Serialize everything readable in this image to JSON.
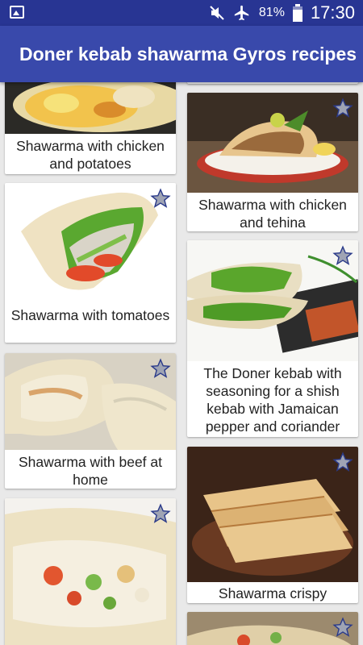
{
  "status_bar": {
    "battery_percent": "81%",
    "time": "17:30",
    "icons": [
      "image-icon",
      "mute-icon",
      "airplane-icon",
      "battery-icon"
    ]
  },
  "app": {
    "title": "Doner kebab shawarma Gyros recipes"
  },
  "colors": {
    "status_bar": "#283593",
    "app_bar": "#3949ab",
    "background": "#e9e9e9",
    "star_fill": "#9fa4b4",
    "star_stroke": "#2a3a8a"
  },
  "recipes": [
    {
      "title": "Shawarma with chicken and potatoes",
      "favorite": false
    },
    {
      "title": "Shawarma with chicken and tehina",
      "favorite": false
    },
    {
      "title": "Shawarma with tomatoes",
      "favorite": false
    },
    {
      "title": "The Doner kebab with seasoning for a shish kebab with Jamaican pepper and coriander",
      "favorite": false
    },
    {
      "title": "Shawarma with beef at home",
      "favorite": false
    },
    {
      "title": "Shawarma crispy",
      "favorite": false
    },
    {
      "title": "",
      "favorite": false
    },
    {
      "title": "",
      "favorite": false
    }
  ]
}
